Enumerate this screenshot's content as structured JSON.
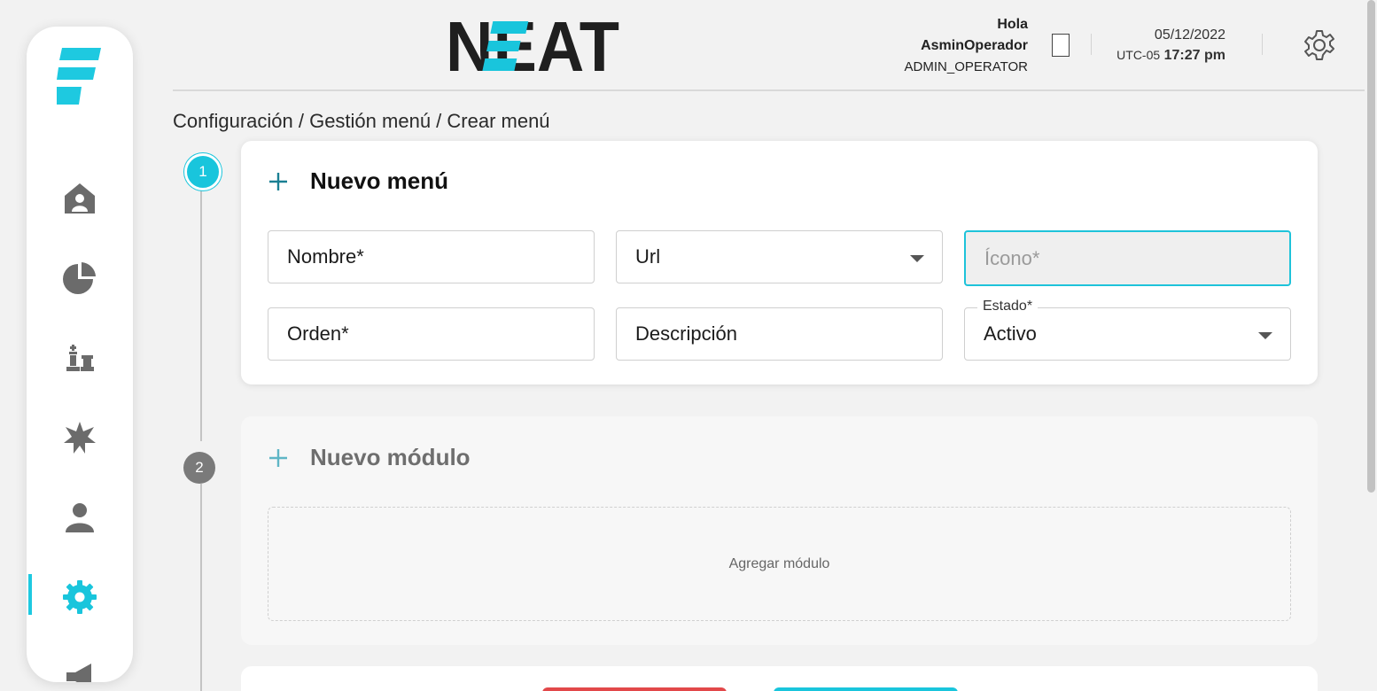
{
  "brand": {
    "name": "NEAT",
    "accent": "#19c5dc",
    "dark": "#1f1f1f"
  },
  "sidebar": {
    "items": [
      {
        "icon": "home-icon"
      },
      {
        "icon": "pie-chart-icon"
      },
      {
        "icon": "chess-icon"
      },
      {
        "icon": "burst-icon"
      },
      {
        "icon": "user-icon"
      },
      {
        "icon": "gear-icon",
        "active": true
      },
      {
        "icon": "megaphone-icon"
      }
    ]
  },
  "header": {
    "greeting": "Hola",
    "username": "AsminOperador",
    "role": "ADMIN_OPERATOR",
    "date": "05/12/2022",
    "timezone": "UTC-05",
    "time": "17:27 pm"
  },
  "breadcrumb": "Configuración / Gestión menú / Crear menú",
  "stepper": {
    "step1": "1",
    "step2": "2"
  },
  "menu_card": {
    "title": "Nuevo menú",
    "fields": {
      "nombre": "Nombre*",
      "url": "Url",
      "icono": "Ícono*",
      "orden": "Orden*",
      "descripcion": "Descripción",
      "estado_label": "Estado*",
      "estado_value": "Activo"
    }
  },
  "module_card": {
    "title": "Nuevo módulo",
    "dropzone": "Agregar módulo"
  }
}
